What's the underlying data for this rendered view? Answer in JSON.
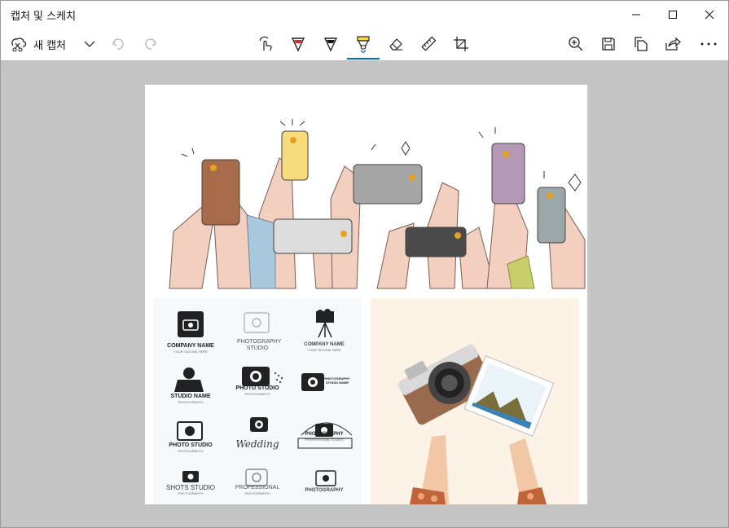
{
  "window": {
    "title": "캡처 및 스케치",
    "controls": [
      "minimize",
      "maximize",
      "close"
    ]
  },
  "toolbar": {
    "new_capture_label": "새 캡처",
    "left_icons": [
      "new-capture-icon",
      "chevron-down-icon",
      "undo-icon",
      "redo-icon"
    ],
    "tools": [
      "touch-writing-icon",
      "ballpoint-pen-icon",
      "pencil-icon",
      "highlighter-icon",
      "eraser-icon",
      "ruler-icon",
      "crop-icon"
    ],
    "active_tool": "highlighter",
    "right_icons": [
      "zoom-in-icon",
      "save-icon",
      "copy-icon",
      "share-icon",
      "more-icon"
    ],
    "accent_color": "#0067c0",
    "pen_color": "#d62b2b",
    "highlighter_color": "#f6d94a"
  },
  "capture": {
    "logos": [
      {
        "name": "COMPANY NAME",
        "sub": "YOUR TAGLINE HERE"
      },
      {
        "name": "PHOTOGRAPHY STUDIO",
        "sub": ""
      },
      {
        "name": "COMPANY NAME",
        "sub": "YOUR TAGLINE HERE"
      },
      {
        "name": "STUDIO NAME",
        "sub": "PHOTOGRAPHY"
      },
      {
        "name": "PHOTO STUDIO",
        "sub": "PHOTOGRAPHY"
      },
      {
        "name": "PHOTOGRAPHY STUDIO NAME",
        "sub": ""
      },
      {
        "name": "PHOTO STUDIO",
        "sub": "PHOTOGRAPHY"
      },
      {
        "name": "Wedding",
        "sub": ""
      },
      {
        "name": "PHOTOGRAPHY",
        "sub": "PROFESSIONAL STUDIO"
      },
      {
        "name": "SHOTS STUDIO",
        "sub": "PHOTOGRAPHY"
      },
      {
        "name": "PROFESSIONAL",
        "sub": "PHOTOGRAPHY"
      },
      {
        "name": "PHOTOGRAPHY",
        "sub": ""
      }
    ]
  }
}
